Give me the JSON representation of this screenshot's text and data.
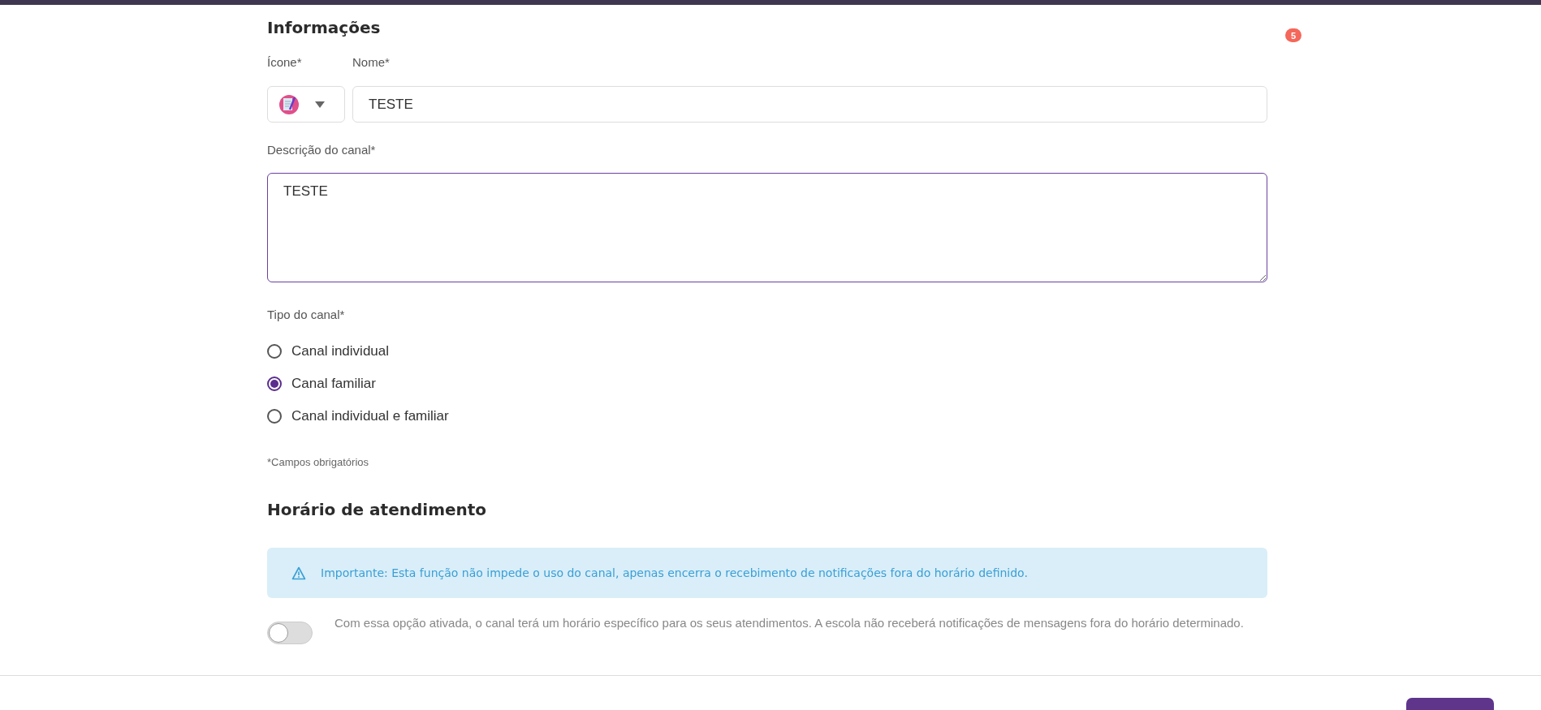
{
  "notification_badge": {
    "count": "5"
  },
  "informacoes": {
    "title": "Informações",
    "icon_label": "Ícone*",
    "name_label": "Nome*",
    "name_value": "TESTE",
    "description_label": "Descrição do canal*",
    "description_value": "TESTE",
    "type_label": "Tipo do canal*",
    "channel_types": [
      {
        "label": "Canal individual",
        "selected": false
      },
      {
        "label": "Canal familiar",
        "selected": true
      },
      {
        "label": "Canal individual e familiar",
        "selected": false
      }
    ],
    "required_note": "*Campos obrigatórios"
  },
  "horario": {
    "title": "Horário de atendimento",
    "notice": "Importante: Esta função não impede o uso do canal, apenas encerra o recebimento de notificações fora do horário definido.",
    "toggle": {
      "on": false,
      "description": "Com essa opção ativada, o canal terá um horário específico para os seus atendimentos. A escola não receberá notificações de mensagens fora do horário determinado."
    }
  }
}
